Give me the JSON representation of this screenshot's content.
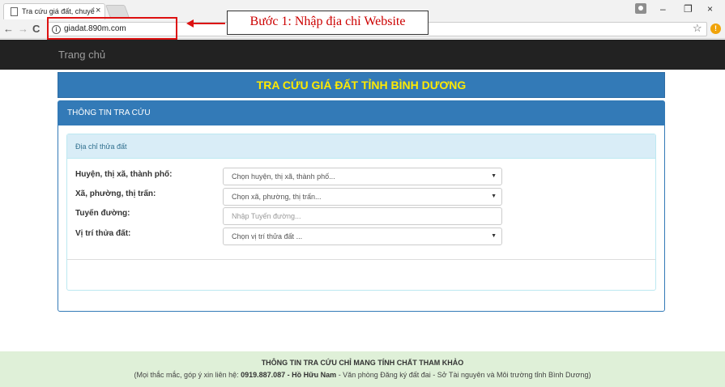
{
  "browser": {
    "tab_title": "Tra cứu giá đất, chuyển m",
    "tab_close": "×",
    "minimize": "–",
    "restore": "❐",
    "close": "×",
    "back": "←",
    "forward": "→",
    "reload": "C",
    "url": "giadat.890m.com",
    "info_icon": "i",
    "star": "☆",
    "alert": "!"
  },
  "annotation": {
    "label": "Bước 1: Nhập địa chỉ Website",
    "color": "#cc0000"
  },
  "navbar": {
    "home": "Trang chủ"
  },
  "banner": {
    "title": "TRA CỨU GIÁ ĐẤT TỈNH BÌNH DƯƠNG"
  },
  "panel": {
    "heading": "THÔNG TIN TRA CỨU",
    "subheading": "Địa chỉ thửa đất",
    "fields": [
      {
        "label": "Huyện, thị xã, thành phố:",
        "value": "Chọn huyện, thị xã, thành phố..."
      },
      {
        "label": "Xã, phường, thị trấn:",
        "value": "Chọn xã, phường, thị trấn..."
      },
      {
        "label": "Tuyến đường:",
        "placeholder": "Nhập Tuyến đường..."
      },
      {
        "label": "Vị trí thửa đất:",
        "value": "Chọn vị trí thửa đất ..."
      }
    ],
    "caret": "▼"
  },
  "footer": {
    "title": "THÔNG TIN TRA CỨU CHỈ MANG TÍNH CHẤT THAM KHẢO",
    "contact_prefix": "(Mọi thắc mắc, góp ý xin liên hệ: ",
    "contact_bold": "0919.887.087 - Hồ Hữu Nam",
    "contact_suffix": " - Văn phòng Đăng ký đất đai - Sở Tài nguyên và Môi trường tỉnh Bình Dương)"
  },
  "colors": {
    "primary": "#337ab7",
    "banner_text": "#ffea00",
    "navbar": "#222222",
    "footer_bg": "#dff0d8",
    "annotation": "#cc0000"
  }
}
